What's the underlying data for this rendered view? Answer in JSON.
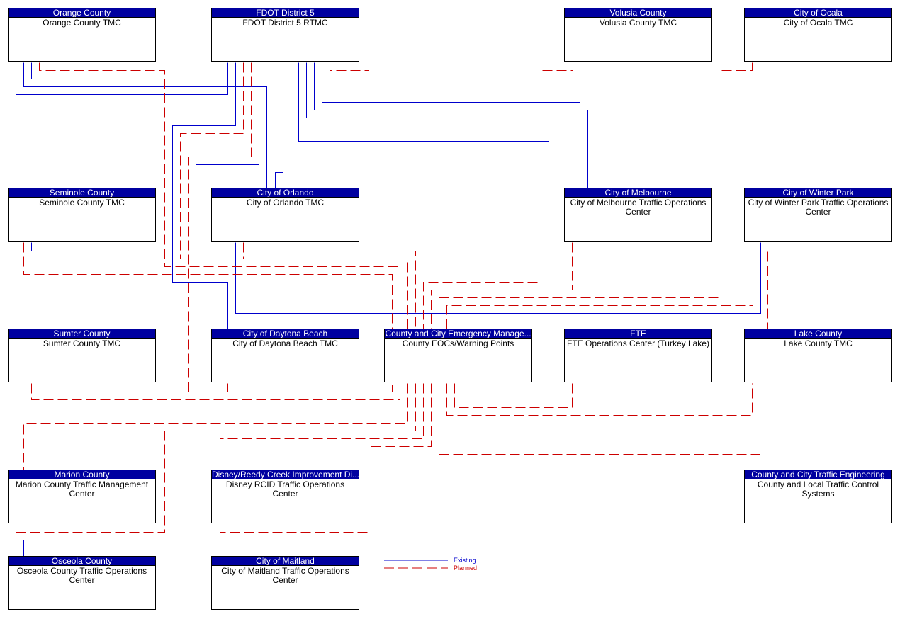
{
  "colors": {
    "existing": "#0000cc",
    "planned": "#cc0000",
    "header": "#0000a0"
  },
  "nodes": {
    "orange": {
      "header": "Orange County",
      "body": "Orange County TMC"
    },
    "fdot": {
      "header": "FDOT District 5",
      "body": "FDOT District 5 RTMC"
    },
    "volusia": {
      "header": "Volusia County",
      "body": "Volusia County TMC"
    },
    "ocala": {
      "header": "City of Ocala",
      "body": "City of Ocala TMC"
    },
    "seminole": {
      "header": "Seminole County",
      "body": "Seminole County TMC"
    },
    "orlando": {
      "header": "City of Orlando",
      "body": "City of Orlando TMC"
    },
    "melbourne": {
      "header": "City of Melbourne",
      "body": "City of Melbourne Traffic Operations Center"
    },
    "winterpark": {
      "header": "City of Winter Park",
      "body": "City of Winter Park Traffic Operations Center"
    },
    "sumter": {
      "header": "Sumter County",
      "body": "Sumter County TMC"
    },
    "daytona": {
      "header": "City of Daytona Beach",
      "body": "City of Daytona Beach TMC"
    },
    "eoc": {
      "header": "County and City Emergency Manage...",
      "body": "County EOCs/Warning Points"
    },
    "fte": {
      "header": "FTE",
      "body": "FTE Operations Center (Turkey Lake)"
    },
    "lake": {
      "header": "Lake County",
      "body": "Lake County TMC"
    },
    "marion": {
      "header": "Marion County",
      "body": "Marion County Traffic Management Center"
    },
    "disney": {
      "header": "Disney/Reedy Creek Improvement Di...",
      "body": "Disney RCID Traffic Operations Center"
    },
    "trafficeng": {
      "header": "County and City Traffic Engineering",
      "body": "County and Local Traffic Control Systems"
    },
    "osceola": {
      "header": "Osceola County",
      "body": "Osceola County Traffic Operations Center"
    },
    "maitland": {
      "header": "City of Maitland",
      "body": "City of Maitland Traffic Operations Center"
    }
  },
  "connections": [
    {
      "from": "orange",
      "to": "orlando",
      "status": "existing"
    },
    {
      "from": "orange",
      "to": "fdot",
      "status": "existing"
    },
    {
      "from": "seminole",
      "to": "fdot",
      "status": "existing"
    },
    {
      "from": "fdot",
      "to": "daytona",
      "status": "existing"
    },
    {
      "from": "fdot",
      "to": "osceola",
      "status": "existing"
    },
    {
      "from": "fdot",
      "to": "orlando",
      "status": "existing"
    },
    {
      "from": "fdot",
      "to": "fte",
      "status": "existing"
    },
    {
      "from": "fdot",
      "to": "ocala",
      "status": "existing"
    },
    {
      "from": "fdot",
      "to": "melbourne",
      "status": "existing"
    },
    {
      "from": "fdot",
      "to": "volusia",
      "status": "existing"
    },
    {
      "from": "seminole",
      "to": "orlando",
      "status": "existing"
    },
    {
      "from": "orlando",
      "to": "winterpark",
      "status": "existing"
    },
    {
      "from": "orange",
      "to": "eoc",
      "status": "planned"
    },
    {
      "from": "fdot",
      "to": "sumter",
      "status": "planned"
    },
    {
      "from": "fdot",
      "to": "marion",
      "status": "planned"
    },
    {
      "from": "fdot",
      "to": "lake",
      "status": "planned"
    },
    {
      "from": "fdot",
      "to": "eoc",
      "status": "planned"
    },
    {
      "from": "seminole",
      "to": "eoc",
      "status": "planned"
    },
    {
      "from": "orlando",
      "to": "eoc",
      "status": "planned"
    },
    {
      "from": "volusia",
      "to": "eoc",
      "status": "planned"
    },
    {
      "from": "melbourne",
      "to": "eoc",
      "status": "planned"
    },
    {
      "from": "ocala",
      "to": "eoc",
      "status": "planned"
    },
    {
      "from": "winterpark",
      "to": "eoc",
      "status": "planned"
    },
    {
      "from": "sumter",
      "to": "eoc",
      "status": "planned"
    },
    {
      "from": "daytona",
      "to": "eoc",
      "status": "planned"
    },
    {
      "from": "eoc",
      "to": "marion",
      "status": "planned"
    },
    {
      "from": "eoc",
      "to": "osceola",
      "status": "planned"
    },
    {
      "from": "eoc",
      "to": "disney",
      "status": "planned"
    },
    {
      "from": "eoc",
      "to": "maitland",
      "status": "planned"
    },
    {
      "from": "eoc",
      "to": "trafficeng",
      "status": "planned"
    },
    {
      "from": "eoc",
      "to": "lake",
      "status": "planned"
    },
    {
      "from": "eoc",
      "to": "fte",
      "status": "planned"
    }
  ],
  "legend": {
    "existing": "Existing",
    "planned": "Planned"
  }
}
